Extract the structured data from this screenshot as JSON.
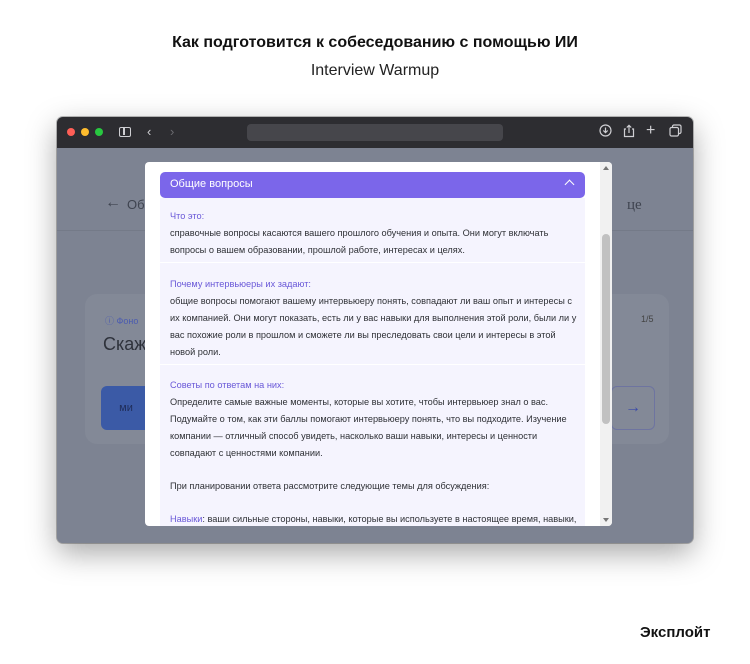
{
  "header": {
    "title": "Как подготовится к собеседованию с помощью ИИ",
    "subtitle": "Interview Warmup"
  },
  "footer": {
    "brand": "Эксплойт"
  },
  "browser": {
    "icons": [
      "sidebar-icon",
      "chevron-left-icon",
      "chevron-right-icon",
      "download-icon",
      "share-icon",
      "plus-icon",
      "tabs-icon"
    ]
  },
  "page": {
    "back_label": "Об",
    "corner_text": "це",
    "card": {
      "tag": "Фоно",
      "counter": "1/5",
      "question": "Скаж",
      "button_label": "ми"
    }
  },
  "modal": {
    "title": "Общие вопросы",
    "sections": [
      {
        "label": "Что это:",
        "text": "справочные вопросы касаются вашего прошлого обучения и опыта. Они могут включать вопросы о вашем образовании, прошлой работе, интересах и целях."
      },
      {
        "label": "Почему интервьюеры их задают:",
        "text": "общие вопросы помогают вашему интервьюеру понять, совпадают ли ваш опыт и интересы с их компанией. Они могут показать, есть ли у вас навыки для выполнения этой роли, были ли у вас похожие роли в прошлом и сможете ли вы преследовать свои цели и интересы в этой новой роли."
      },
      {
        "label": "Советы по ответам на них:",
        "text": "Определите самые важные моменты, которые вы хотите, чтобы интервьюер знал о вас. Подумайте о том, как эти баллы помогают интервьюеру понять, что вы подходите. Изучение компании — отличный способ увидеть, насколько ваши навыки, интересы и ценности совпадают с ценностями компании."
      },
      {
        "label": "",
        "text": "При планировании ответа рассмотрите следующие темы для обсуждения:"
      },
      {
        "label": "Навыки",
        "text": ": ваши сильные стороны, навыки, которые вы используете в настоящее время, навыки,"
      }
    ]
  },
  "colors": {
    "modal_header": "#7b66ea",
    "accent_label": "#6a59d8",
    "overlay": "#7d8392"
  }
}
